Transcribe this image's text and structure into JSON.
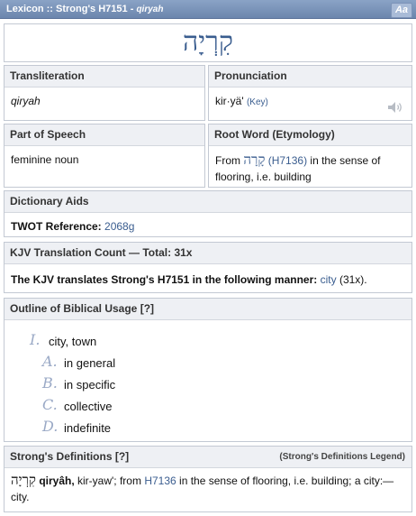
{
  "title": {
    "main": "Lexicon :: Strong's H7151 - ",
    "sub": "qiryah",
    "aa": "Aa"
  },
  "hebrew_word": "קִרְיָה",
  "transliteration": {
    "label": "Transliteration",
    "value": "qiryah"
  },
  "pronunciation": {
    "label": "Pronunciation",
    "value": "kir·yä'",
    "key": "(Key)"
  },
  "part_of_speech": {
    "label": "Part of Speech",
    "value": "feminine noun"
  },
  "root": {
    "label": "Root Word (Etymology)",
    "from": "From",
    "heb": "קָרָה",
    "ref": "(H7136)",
    "rest": "in the sense of flooring, i.e. building"
  },
  "dictionary_aids": {
    "label": "Dictionary Aids",
    "twot_label": "TWOT Reference:",
    "twot_value": "2068g"
  },
  "kjv": {
    "label": "KJV Translation Count — Total: 31x",
    "text": "The KJV translates Strong's H7151 in the following manner:",
    "link": "city",
    "count": "(31x)."
  },
  "outline": {
    "label": "Outline of Biblical Usage [?]",
    "main": {
      "marker": "I.",
      "text": "city, town"
    },
    "subs": [
      {
        "marker": "A.",
        "text": "in general"
      },
      {
        "marker": "B.",
        "text": "in specific"
      },
      {
        "marker": "C.",
        "text": "collective"
      },
      {
        "marker": "D.",
        "text": "indefinite"
      }
    ]
  },
  "strongs": {
    "label": "Strong's Definitions [?]",
    "legend": "(Strong's Definitions Legend)",
    "heb": "קִרְיָה",
    "translit": "qiryâh,",
    "pron": "kir-yaw'; from",
    "ref": "H7136",
    "rest": "in the sense of flooring, i.e. building; a city:—",
    "tail": "city."
  }
}
